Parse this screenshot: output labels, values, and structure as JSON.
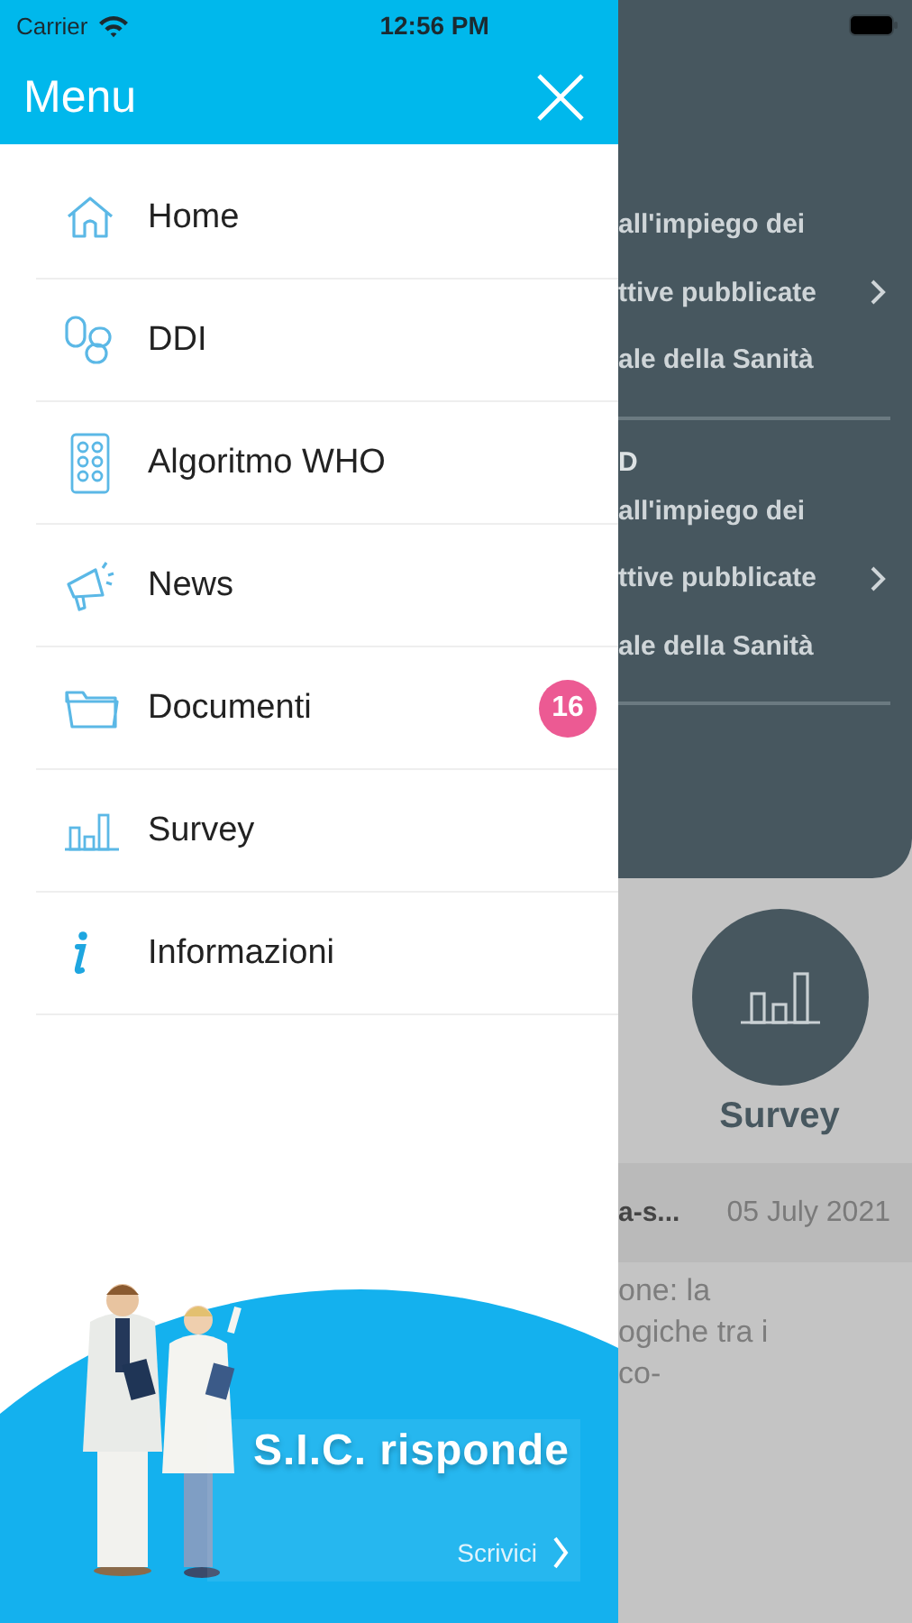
{
  "status_bar": {
    "carrier": "Carrier",
    "time": "12:56 PM"
  },
  "menu": {
    "title": "Menu",
    "items": [
      {
        "label": "Home",
        "kind": "home"
      },
      {
        "label": "DDI",
        "kind": "pills"
      },
      {
        "label": "Algoritmo WHO",
        "kind": "blister"
      },
      {
        "label": "News",
        "kind": "megaphone"
      },
      {
        "label": "Documenti",
        "kind": "folder",
        "badge": "16"
      },
      {
        "label": "Survey",
        "kind": "chart"
      },
      {
        "label": "Informazioni",
        "kind": "info"
      }
    ]
  },
  "banner": {
    "title": "S.I.C. risponde",
    "action": "Scrivici"
  },
  "background_page": {
    "sections": [
      {
        "lines": [
          {
            "text": "all'impiego dei",
            "chevron": false
          },
          {
            "text": "ttive pubblicate",
            "chevron": true
          },
          {
            "text": "ale della Sanità",
            "chevron": false
          }
        ]
      },
      {
        "heading": "D",
        "lines": [
          {
            "text": "all'impiego dei",
            "chevron": false
          },
          {
            "text": "ttive pubblicate",
            "chevron": true
          },
          {
            "text": "ale della Sanità",
            "chevron": false
          }
        ]
      }
    ],
    "tile": {
      "label": "Survey"
    },
    "news": {
      "title": "a-s...",
      "date": "05 July 2021",
      "lines": [
        "one: la",
        "ogiche tra i",
        "co-"
      ]
    }
  }
}
